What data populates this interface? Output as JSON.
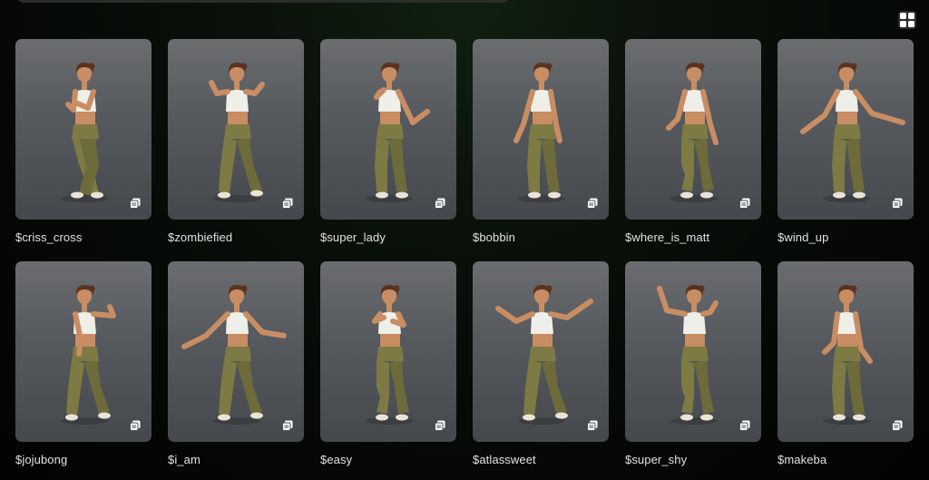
{
  "toolbar": {
    "view_toggle_icon": "grid-view-icon"
  },
  "colors": {
    "card_bg": "#5a5d61",
    "label": "#e2e2e2",
    "skin": "#c98d63",
    "pants": "#7d7a44",
    "top": "#efefe9",
    "hair": "#5a3220"
  },
  "items": [
    {
      "label": "$criss_cross",
      "pose": "criss"
    },
    {
      "label": "$zombiefied",
      "pose": "arms-up"
    },
    {
      "label": "$super_lady",
      "pose": "salute"
    },
    {
      "label": "$bobbin",
      "pose": "down"
    },
    {
      "label": "$where_is_matt",
      "pose": "bent"
    },
    {
      "label": "$wind_up",
      "pose": "wide"
    },
    {
      "label": "$jojubong",
      "pose": "lean"
    },
    {
      "label": "$i_am",
      "pose": "wide-low"
    },
    {
      "label": "$easy",
      "pose": "cross"
    },
    {
      "label": "$atlassweet",
      "pose": "wide-up"
    },
    {
      "label": "$super_shy",
      "pose": "diag"
    },
    {
      "label": "$makeba",
      "pose": "hips"
    }
  ]
}
